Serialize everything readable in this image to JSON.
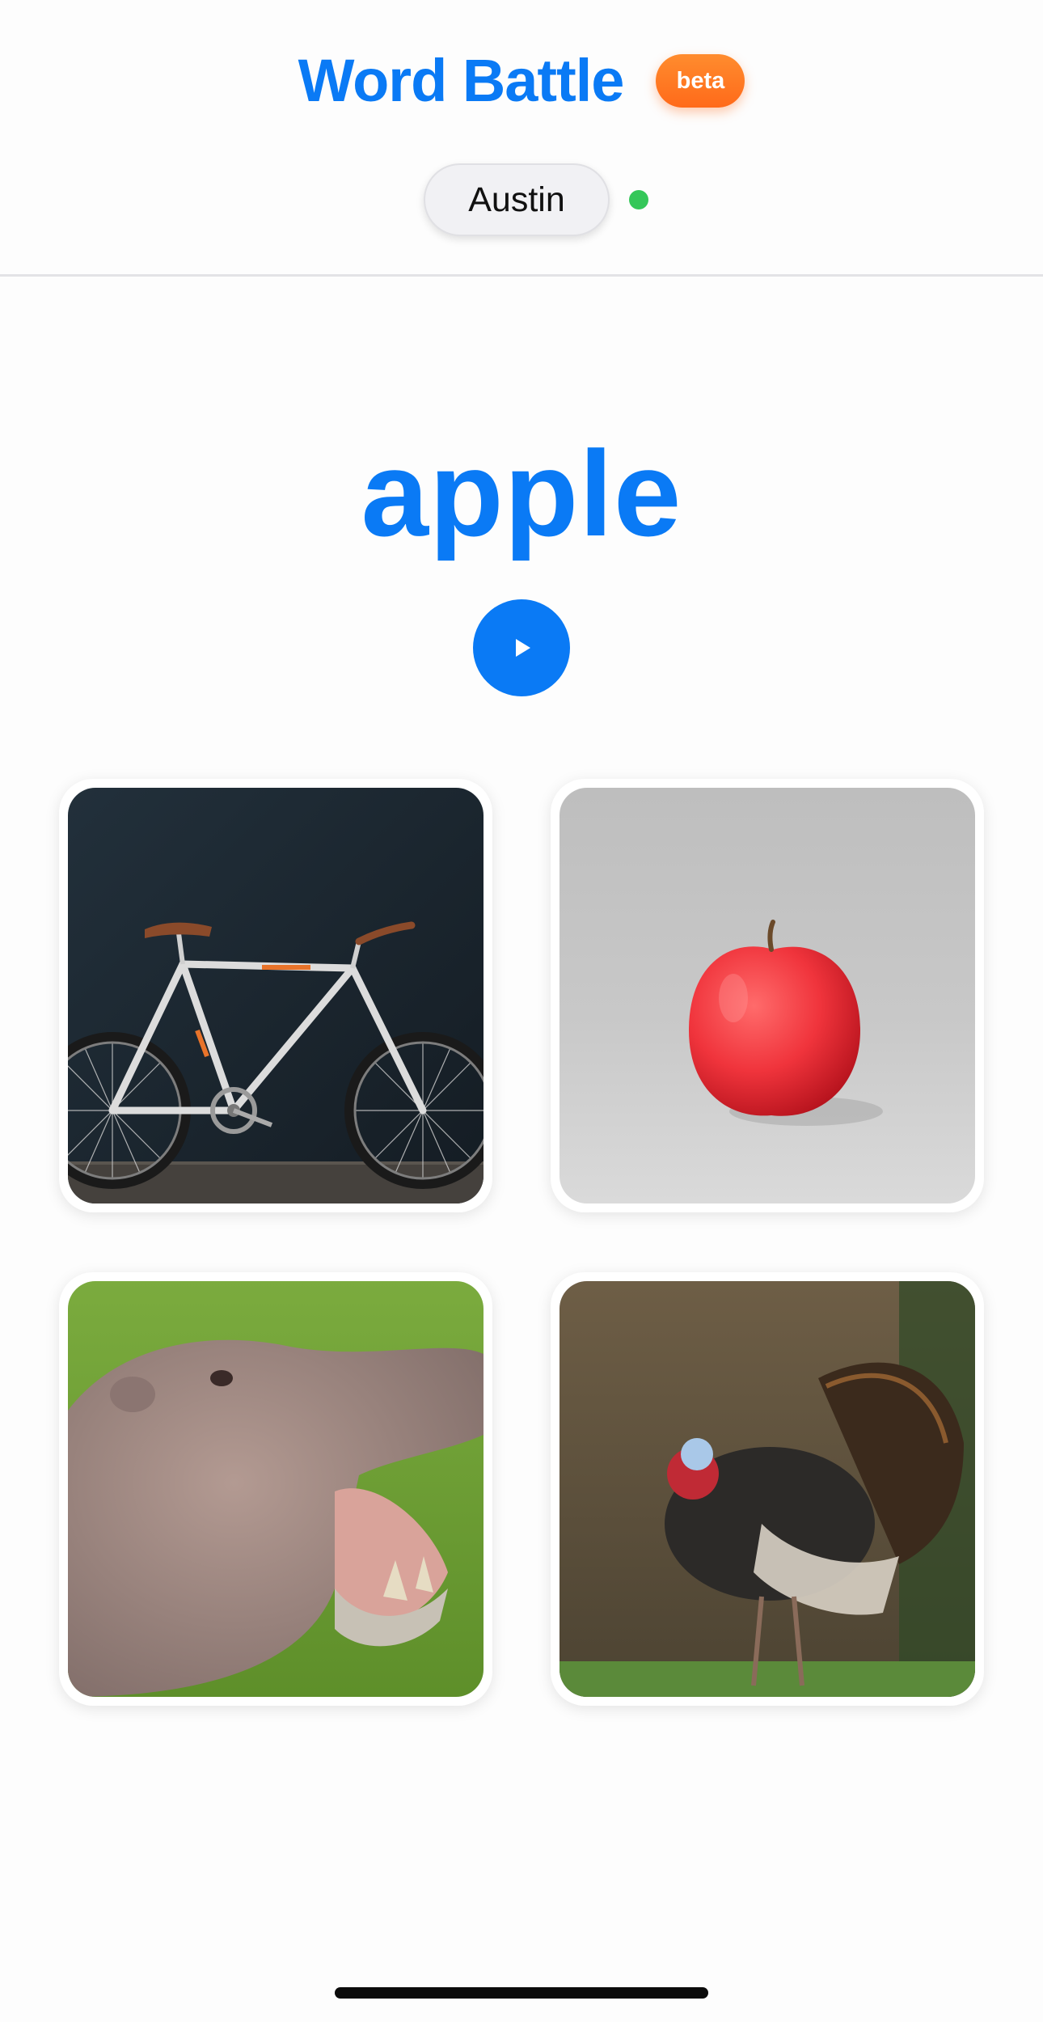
{
  "header": {
    "app_title": "Word Battle",
    "badge": "beta",
    "user_name": "Austin",
    "status": "online",
    "accent_color": "#0a7af5",
    "badge_color": "#ff7a22",
    "status_color": "#34c759"
  },
  "prompt": {
    "word": "apple",
    "play_icon": "play-icon"
  },
  "choices": [
    {
      "subject": "bicycle",
      "icon": "bicycle-image"
    },
    {
      "subject": "apple",
      "icon": "apple-image"
    },
    {
      "subject": "hippopotamus",
      "icon": "hippo-image"
    },
    {
      "subject": "turkey",
      "icon": "turkey-image"
    }
  ]
}
